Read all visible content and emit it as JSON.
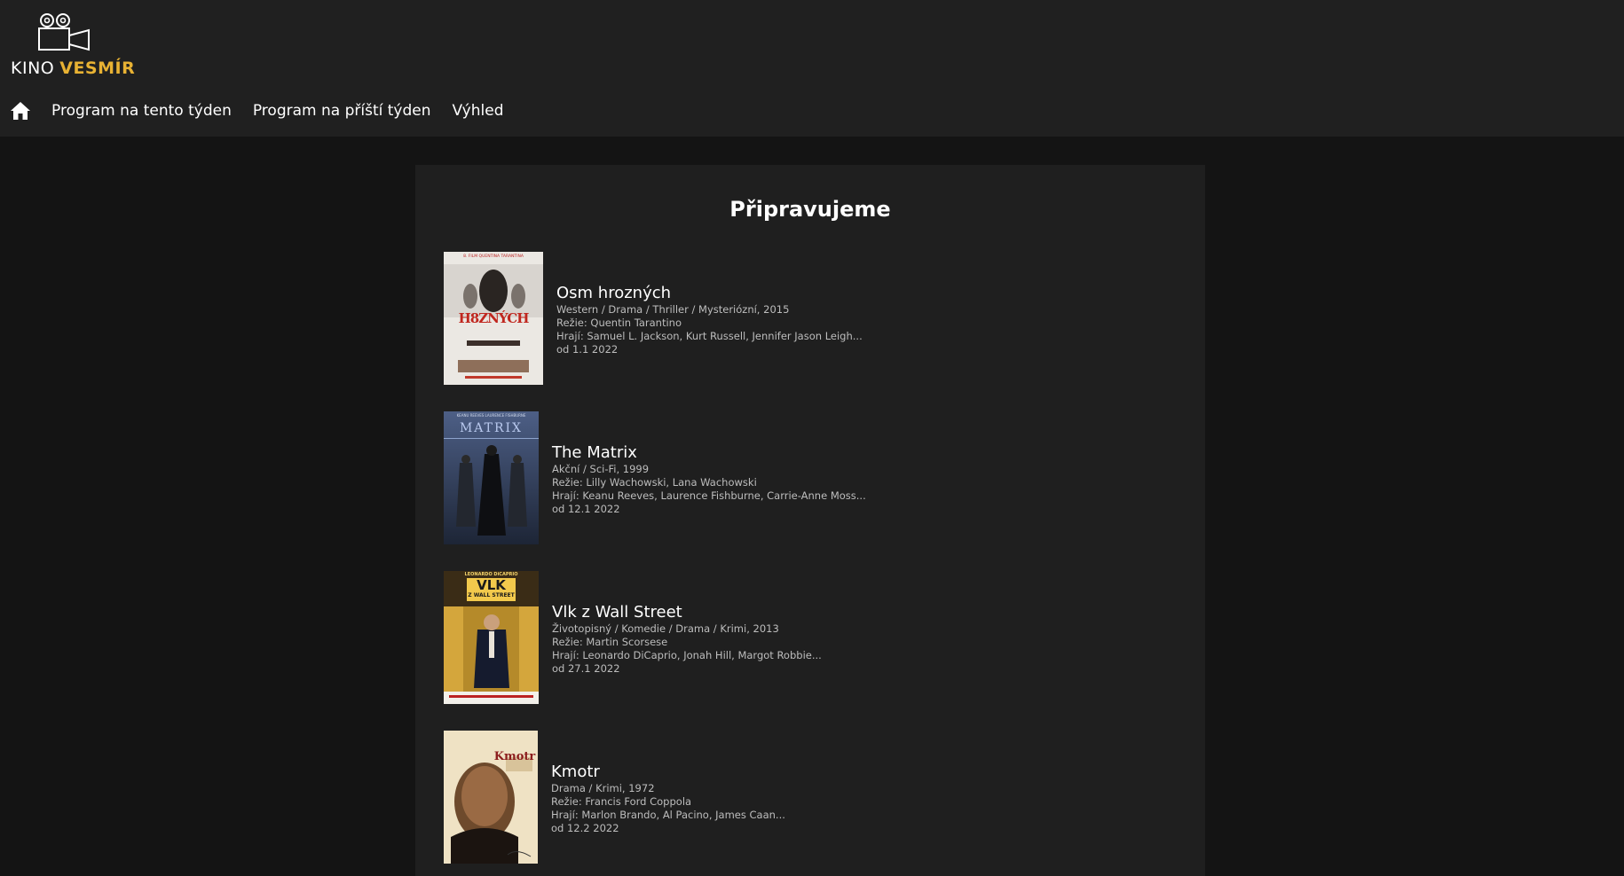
{
  "brand": {
    "kino": "KINO",
    "vesmir": "VESMÍR",
    "accent_color": "#e8b233",
    "icon": "film-camera-icon"
  },
  "nav": {
    "home_icon": "home-icon",
    "items": [
      "Program na tento týden",
      "Program na příští týden",
      "Výhled"
    ]
  },
  "main": {
    "title": "Připravujeme",
    "films": [
      {
        "title": "Osm hrozných",
        "genres": "Western / Drama / Thriller / Mysteriózní, 2015",
        "director": "Režie: Quentin Tarantino",
        "cast": "Hrají: Samuel L. Jackson, Kurt Russell, Jennifer Jason Leigh...",
        "date": "od 1.1 2022",
        "poster_text": "H8ZNÝCH",
        "poster_top": "8. FILM QUENTINA TARANTINA"
      },
      {
        "title": "The Matrix",
        "genres": "Akční / Sci-Fi, 1999",
        "director": "Režie: Lilly Wachowski, Lana Wachowski",
        "cast": "Hrají: Keanu Reeves, Laurence Fishburne, Carrie-Anne Moss...",
        "date": "od 12.1 2022",
        "poster_text": "MATRIX",
        "poster_top": "KEANU REEVES LAURENCE FISHBURNE"
      },
      {
        "title": "Vlk z Wall Street",
        "genres": "Životopisný / Komedie / Drama / Krimi, 2013",
        "director": "Režie: Martin Scorsese",
        "cast": "Hrají: Leonardo DiCaprio, Jonah Hill, Margot Robbie...",
        "date": "od 27.1 2022",
        "poster_text": "VLK",
        "poster_sub": "Z WALL STREET",
        "poster_top": "LEONARDO DiCAPRIO"
      },
      {
        "title": "Kmotr",
        "genres": "Drama / Krimi, 1972",
        "director": "Režie: Francis Ford Coppola",
        "cast": "Hrají: Marlon Brando, Al Pacino, James Caan...",
        "date": "od 12.2 2022",
        "poster_text": "Kmotr"
      }
    ]
  }
}
